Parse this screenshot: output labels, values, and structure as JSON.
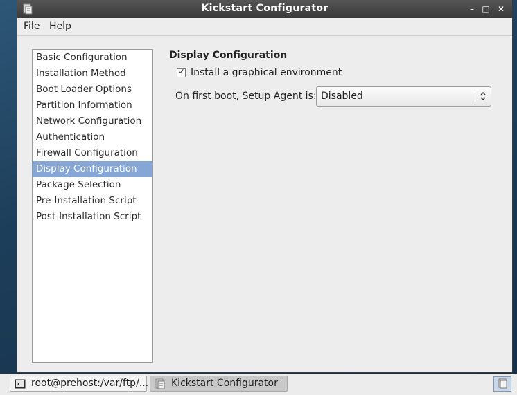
{
  "window": {
    "title": "Kickstart Configurator",
    "controls": {
      "minimize": "–",
      "maximize": "□",
      "close": "✕"
    }
  },
  "menu": {
    "file": "File",
    "help": "Help"
  },
  "sidebar": {
    "items": [
      "Basic Configuration",
      "Installation Method",
      "Boot Loader Options",
      "Partition Information",
      "Network Configuration",
      "Authentication",
      "Firewall Configuration",
      "Display Configuration",
      "Package Selection",
      "Pre-Installation Script",
      "Post-Installation Script"
    ],
    "selected": "Display Configuration"
  },
  "content": {
    "title": "Display Configuration",
    "checkbox_label": "Install a graphical environment",
    "checkbox_checked": true,
    "check_glyph": "✓",
    "agent_label": "On first boot, Setup Agent is:",
    "agent_value": "Disabled"
  },
  "taskbar": {
    "terminal_label": "root@prehost:/var/ftp/...",
    "kickstart_label": "Kickstart Configurator"
  },
  "colors": {
    "selection": "#86a6d6",
    "titlebar": "#3a3a3a"
  },
  "icons": {
    "app": "kickstart-app-icon",
    "terminal": "terminal-icon",
    "tray": "workspace-switcher-icon"
  }
}
